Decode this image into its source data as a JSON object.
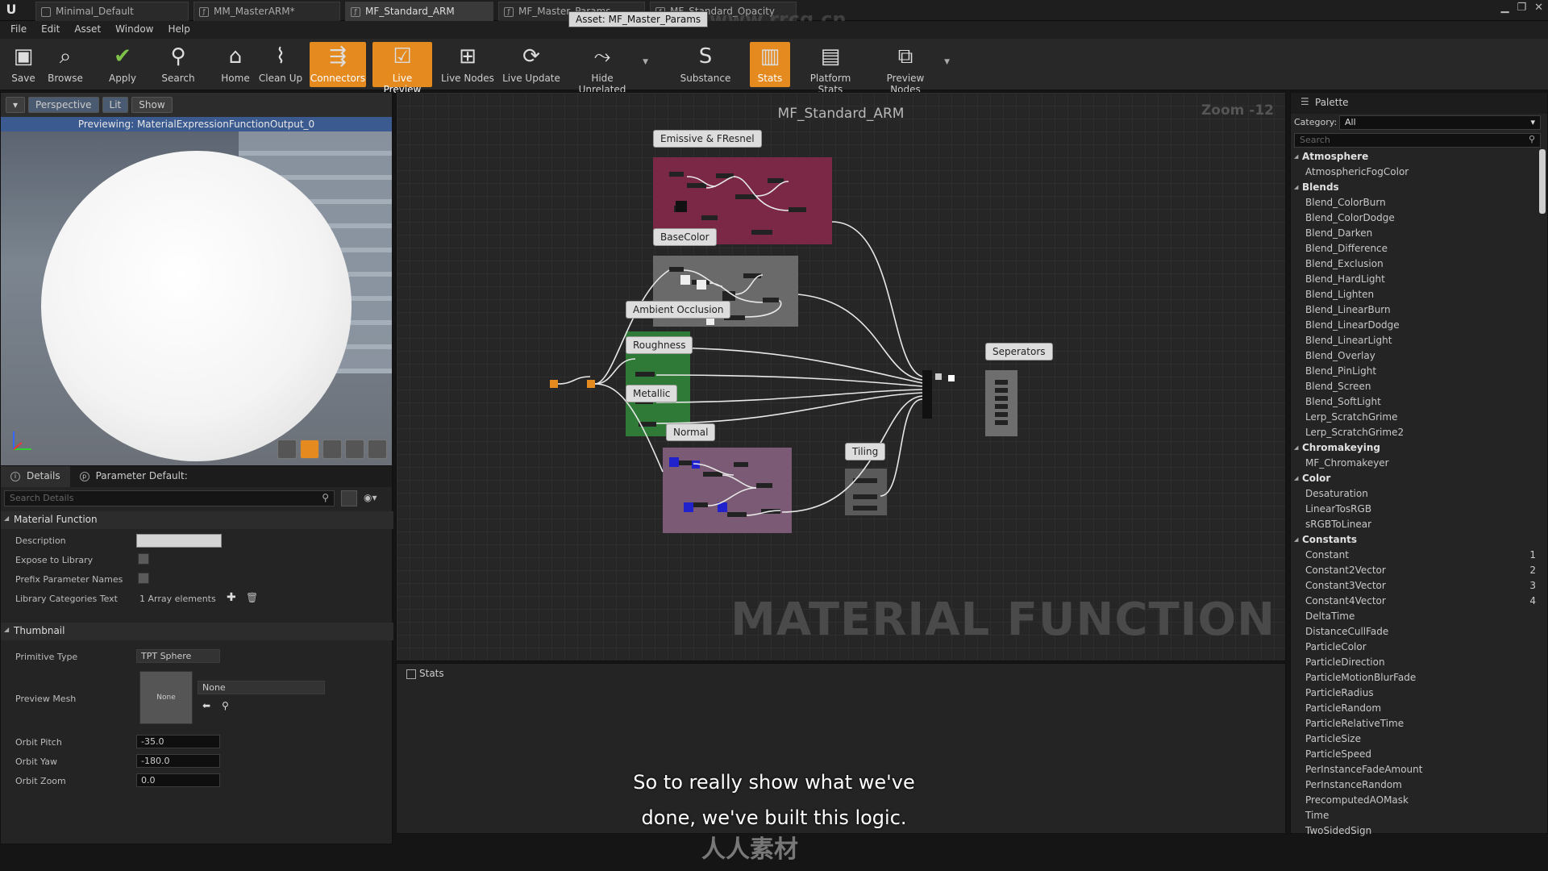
{
  "titlebar": {
    "tabs": [
      "Minimal_Default",
      "MM_MasterARM*",
      "MF_Standard_ARM",
      "MF_Master_Params",
      "MF_Standard_Opacity"
    ],
    "tooltip": "Asset: MF_Master_Params",
    "watermark": "www.rrcg.cn"
  },
  "menu": [
    "File",
    "Edit",
    "Asset",
    "Window",
    "Help"
  ],
  "toolbar": {
    "save": "Save",
    "browse": "Browse",
    "apply": "Apply",
    "search": "Search",
    "home": "Home",
    "clean_up": "Clean Up",
    "connectors": "Connectors",
    "live_preview": "Live Preview",
    "live_nodes": "Live Nodes",
    "live_update": "Live Update",
    "hide_unrelated": "Hide Unrelated",
    "substance": "Substance",
    "stats": "Stats",
    "platform_stats": "Platform Stats",
    "preview_nodes": "Preview Nodes"
  },
  "viewport": {
    "perspective": "Perspective",
    "lit": "Lit",
    "show": "Show",
    "previewing": "Previewing: MaterialExpressionFunctionOutput_0"
  },
  "details": {
    "tab_details": "Details",
    "tab_params": "Parameter Default:",
    "search_placeholder": "Search Details",
    "cat_material_function": "Material Function",
    "description": "Description",
    "expose": "Expose to Library",
    "prefix": "Prefix Parameter Names",
    "lib_cat": "Library Categories Text",
    "lib_cat_val": "1 Array elements",
    "cat_thumbnail": "Thumbnail",
    "primitive_type": "Primitive Type",
    "primitive_val": "TPT Sphere",
    "preview_mesh": "Preview Mesh",
    "preview_mesh_thumb": "None",
    "preview_mesh_val": "None",
    "orbit_pitch": "Orbit Pitch",
    "orbit_pitch_val": "-35.0",
    "orbit_yaw": "Orbit Yaw",
    "orbit_yaw_val": "-180.0",
    "orbit_zoom": "Orbit Zoom",
    "orbit_zoom_val": "0.0"
  },
  "graph": {
    "title": "MF_Standard_ARM",
    "zoom": "Zoom -12",
    "label": "MATERIAL FUNCTION",
    "comments": {
      "emissive": "Emissive & FResnel",
      "basecolor": "BaseColor",
      "ambient": "Ambient Occlusion",
      "roughness": "Roughness",
      "metallic": "Metallic",
      "normal": "Normal",
      "tiling": "Tiling",
      "seperators": "Seperators"
    },
    "colors": {
      "emissive": "#7a2846",
      "basecolor": "#6a6a6a",
      "green": "#2f7a37",
      "normal": "#7a5a74",
      "tiling": "#5a5a5a",
      "seperators": "#6e6e6e"
    }
  },
  "stats": {
    "title": "Stats"
  },
  "palette": {
    "title": "Palette",
    "category_label": "Category:",
    "category_value": "All",
    "search_placeholder": "Search",
    "groups": [
      {
        "name": "Atmosphere",
        "items": [
          {
            "label": "AtmosphericFogColor"
          }
        ]
      },
      {
        "name": "Blends",
        "items": [
          {
            "label": "Blend_ColorBurn"
          },
          {
            "label": "Blend_ColorDodge"
          },
          {
            "label": "Blend_Darken"
          },
          {
            "label": "Blend_Difference"
          },
          {
            "label": "Blend_Exclusion"
          },
          {
            "label": "Blend_HardLight"
          },
          {
            "label": "Blend_Lighten"
          },
          {
            "label": "Blend_LinearBurn"
          },
          {
            "label": "Blend_LinearDodge"
          },
          {
            "label": "Blend_LinearLight"
          },
          {
            "label": "Blend_Overlay"
          },
          {
            "label": "Blend_PinLight"
          },
          {
            "label": "Blend_Screen"
          },
          {
            "label": "Blend_SoftLight"
          },
          {
            "label": "Lerp_ScratchGrime"
          },
          {
            "label": "Lerp_ScratchGrime2"
          }
        ]
      },
      {
        "name": "Chromakeying",
        "items": [
          {
            "label": "MF_Chromakeyer"
          }
        ]
      },
      {
        "name": "Color",
        "items": [
          {
            "label": "Desaturation"
          },
          {
            "label": "LinearTosRGB"
          },
          {
            "label": "sRGBToLinear"
          }
        ]
      },
      {
        "name": "Constants",
        "items": [
          {
            "label": "Constant",
            "n": "1"
          },
          {
            "label": "Constant2Vector",
            "n": "2"
          },
          {
            "label": "Constant3Vector",
            "n": "3"
          },
          {
            "label": "Constant4Vector",
            "n": "4"
          },
          {
            "label": "DeltaTime"
          },
          {
            "label": "DistanceCullFade"
          },
          {
            "label": "ParticleColor"
          },
          {
            "label": "ParticleDirection"
          },
          {
            "label": "ParticleMotionBlurFade"
          },
          {
            "label": "ParticleRadius"
          },
          {
            "label": "ParticleRandom"
          },
          {
            "label": "ParticleRelativeTime"
          },
          {
            "label": "ParticleSize"
          },
          {
            "label": "ParticleSpeed"
          },
          {
            "label": "PerInstanceFadeAmount"
          },
          {
            "label": "PerInstanceRandom"
          },
          {
            "label": "PrecomputedAOMask"
          },
          {
            "label": "Time"
          },
          {
            "label": "TwoSidedSign"
          }
        ]
      }
    ]
  },
  "subtitles": {
    "line1": "So to really show what we've",
    "line2": "done, we've built this logic."
  },
  "footer_logo": "人人素材"
}
